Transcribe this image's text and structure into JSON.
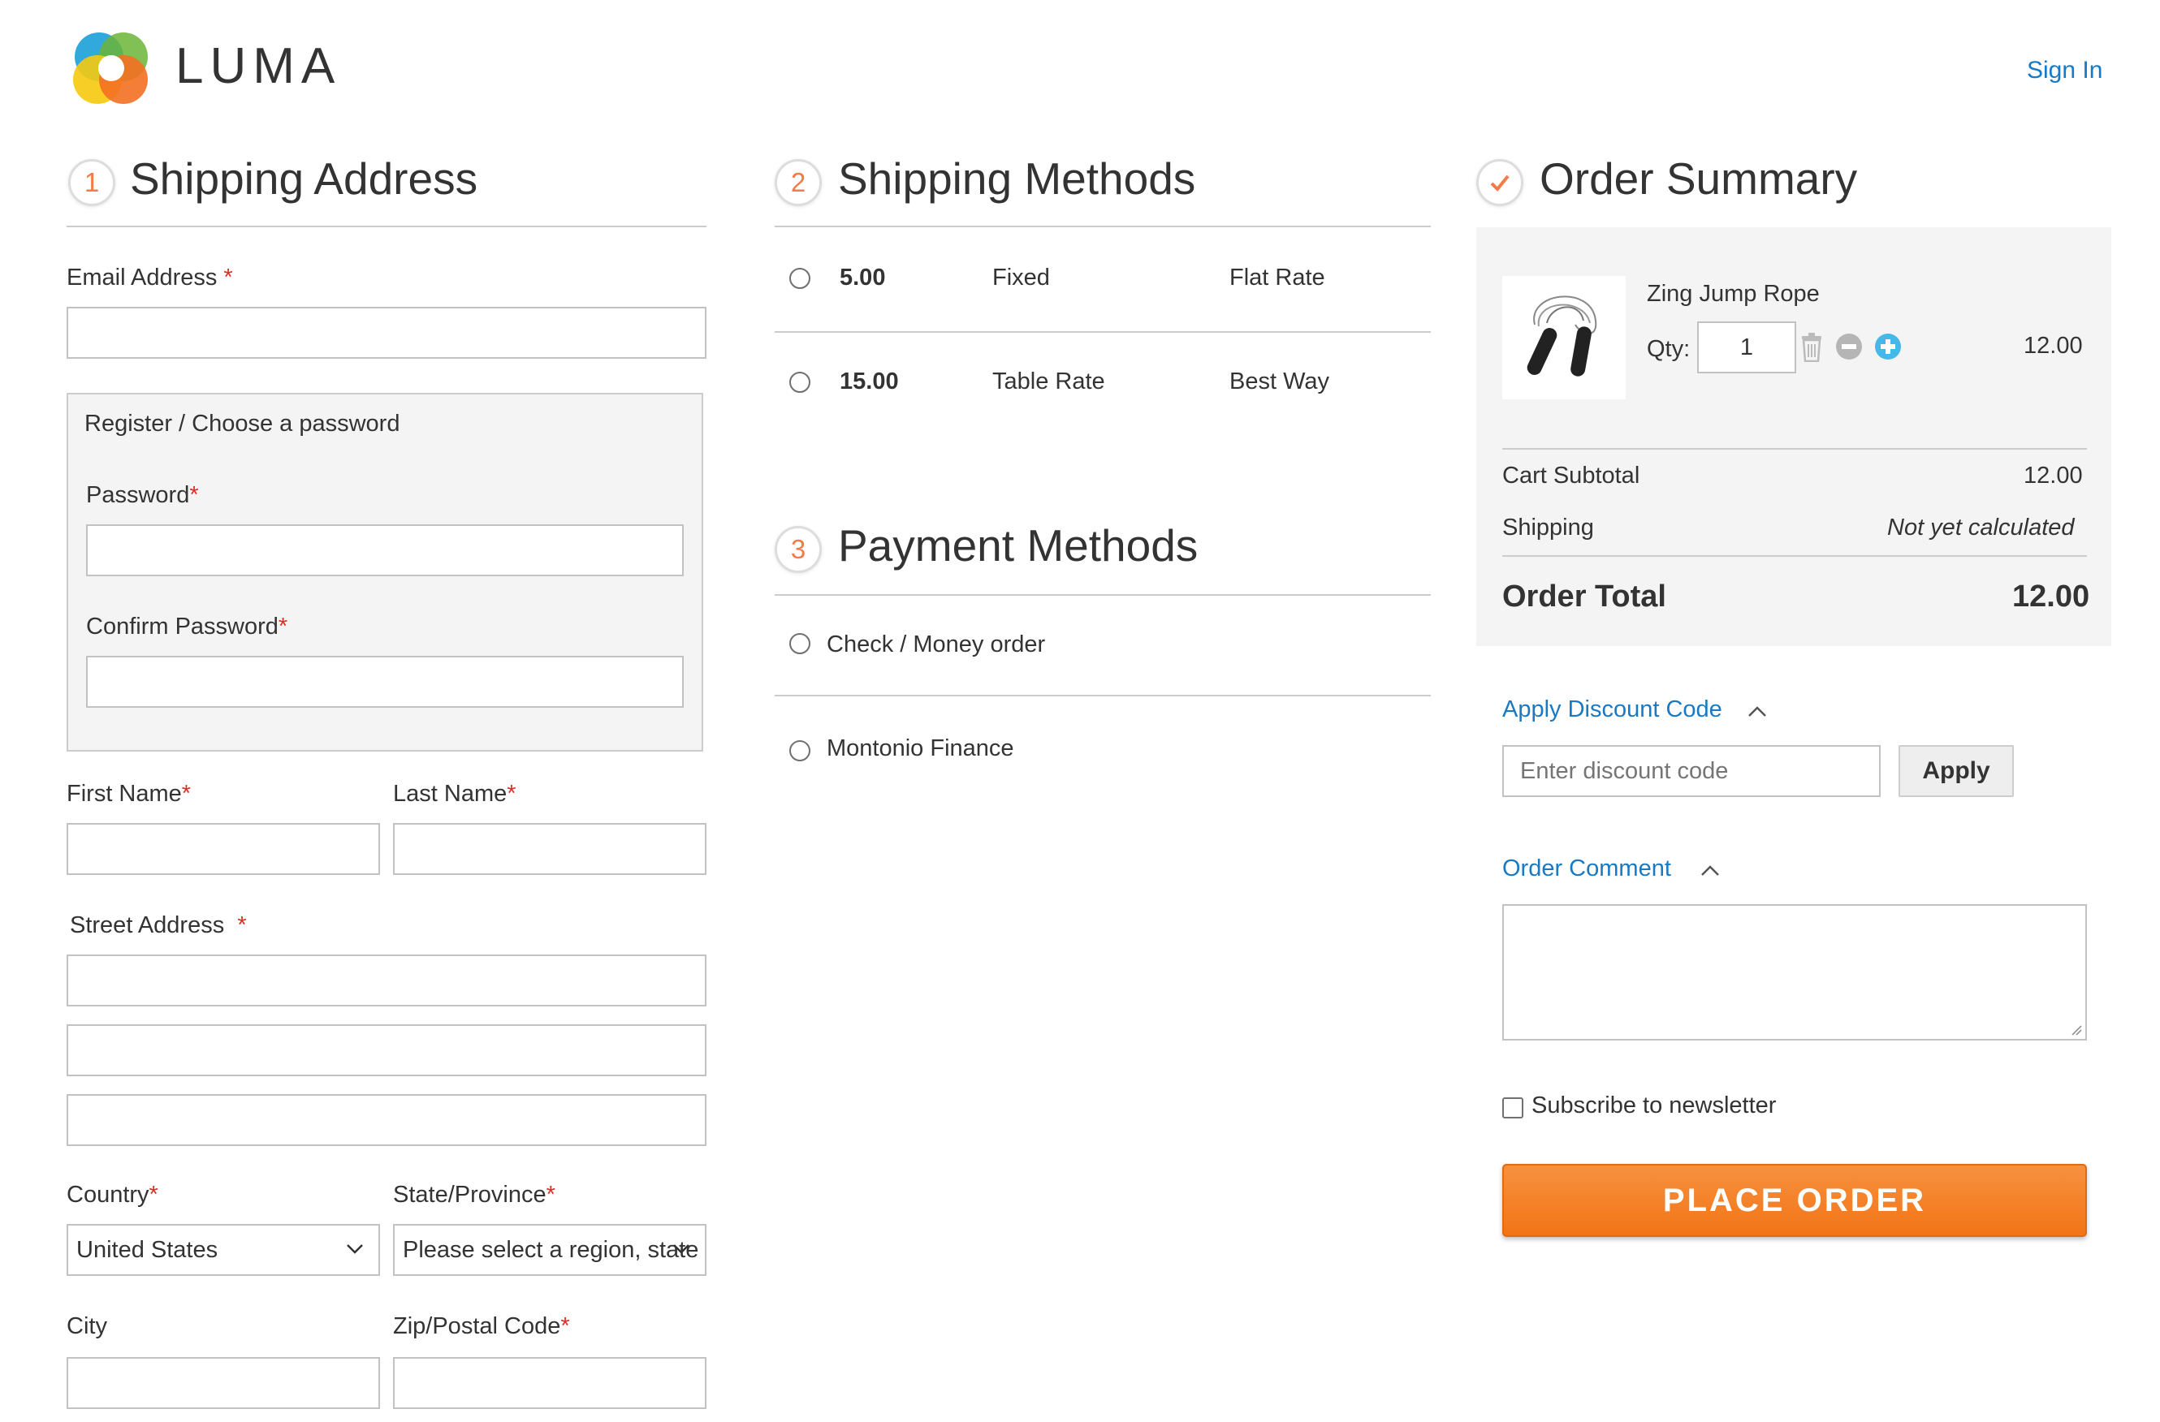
{
  "header": {
    "logo_text": "LUMA",
    "sign_in": "Sign In",
    "brand_colors": [
      "#0ea5e9",
      "#f58220",
      "#f6c90e",
      "#5a9e2f"
    ]
  },
  "shipping_address": {
    "step": "1",
    "title": "Shipping Address",
    "email_label": "Email Address",
    "email_value": "",
    "register_title": "Register / Choose a password",
    "password_label": "Password",
    "confirm_password_label": "Confirm Password",
    "first_name_label": "First Name",
    "last_name_label": "Last Name",
    "street_label": "Street Address",
    "country_label": "Country",
    "country_value": "United States",
    "state_label": "State/Province",
    "state_value": "Please select a region, state or province.",
    "city_label": "City",
    "zip_label": "Zip/Postal Code",
    "required_mark": "*"
  },
  "shipping_methods": {
    "step": "2",
    "title": "Shipping Methods",
    "rows": [
      {
        "price": "5.00",
        "method": "Fixed",
        "carrier": "Flat Rate"
      },
      {
        "price": "15.00",
        "method": "Table Rate",
        "carrier": "Best Way"
      }
    ]
  },
  "payment_methods": {
    "step": "3",
    "title": "Payment Methods",
    "options": [
      "Check / Money order",
      "Montonio Finance"
    ]
  },
  "order_summary": {
    "title": "Order Summary",
    "item": {
      "name": "Zing Jump Rope",
      "qty_label": "Qty:",
      "qty": "1",
      "price": "12.00"
    },
    "cart_subtotal_label": "Cart Subtotal",
    "cart_subtotal": "12.00",
    "shipping_label": "Shipping",
    "shipping_value": "Not yet calculated",
    "order_total_label": "Order Total",
    "order_total": "12.00"
  },
  "discount": {
    "label": "Apply Discount Code",
    "placeholder": "Enter discount code",
    "apply": "Apply"
  },
  "comment": {
    "label": "Order Comment"
  },
  "newsletter": {
    "label": "Subscribe to newsletter",
    "checked": false
  },
  "place_order": "PLACE ORDER",
  "colors": {
    "accent_orange": "#f47b45",
    "link_blue": "#1979c3",
    "required_red": "#e02b27",
    "button_orange": "#f58220"
  }
}
